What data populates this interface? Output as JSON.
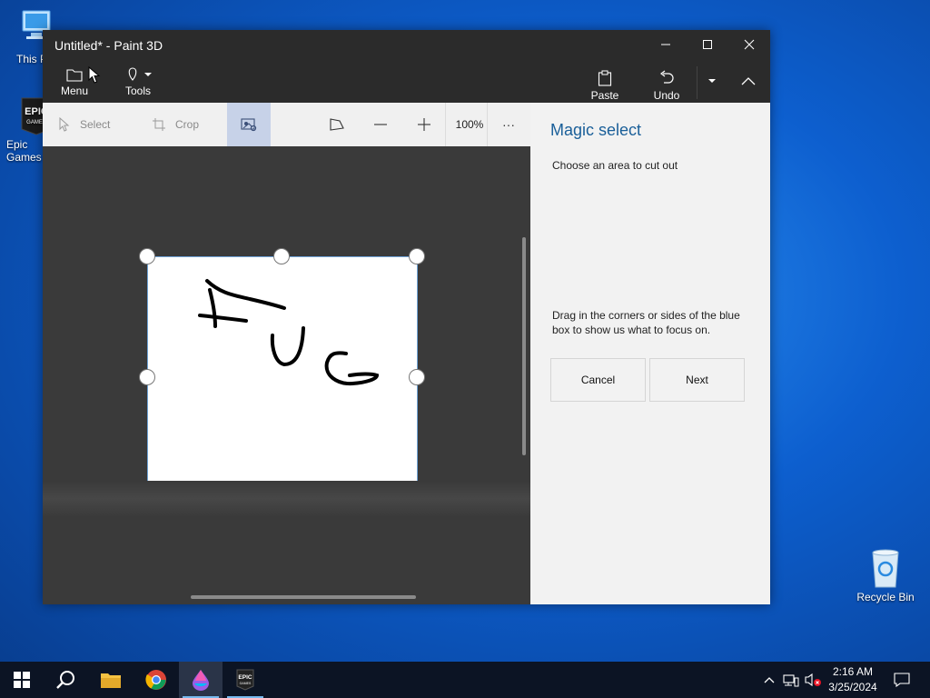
{
  "desktop": {
    "icons": [
      {
        "label": "This PC"
      },
      {
        "label": "Epic Games Launcher"
      },
      {
        "label": "Recycle Bin"
      }
    ]
  },
  "window": {
    "title": "Untitled* - Paint 3D"
  },
  "ribbon": {
    "menu_label": "Menu",
    "tools_label": "Tools",
    "paste_label": "Paste",
    "undo_label": "Undo"
  },
  "toolbar": {
    "select_label": "Select",
    "crop_label": "Crop",
    "zoom_level": "100%",
    "more_label": "···"
  },
  "panel": {
    "title": "Magic select",
    "subtitle": "Choose an area to cut out",
    "hint": "Drag in the corners or sides of the blue box to show us what to focus on.",
    "cancel_label": "Cancel",
    "next_label": "Next"
  },
  "canvas": {
    "drawing_text": "FUG"
  },
  "taskbar": {
    "time": "2:16 AM",
    "date": "3/25/2024"
  },
  "colors": {
    "accent": "#1a5f99",
    "selection_border": "#6fa3d6",
    "active_tool": "#c7d2e8"
  }
}
